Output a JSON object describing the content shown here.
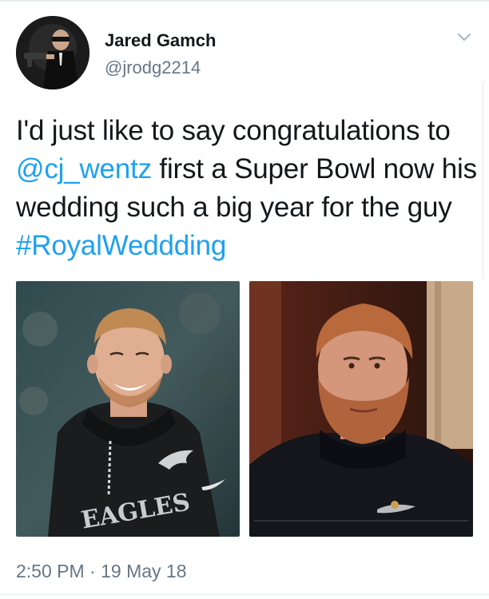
{
  "author": {
    "display_name": "Jared Gamch",
    "handle": "@jrodg2214"
  },
  "icons": {
    "avatar": "profile-photo",
    "menu": "chevron-down-icon"
  },
  "tweet": {
    "segments": {
      "s1": "I'd just like to say congratulations to ",
      "mention": "@cj_wentz",
      "s2": " first a Super Bowl now his wedding such a big year for the guy ",
      "hashtag": "#RoyalWeddding"
    },
    "media": {
      "left_jersey_text": "EAGLES"
    },
    "timestamp": "2:50 PM · 19 May 18"
  },
  "colors": {
    "link": "#1da1f2",
    "text": "#14171a",
    "secondary": "#657786"
  }
}
